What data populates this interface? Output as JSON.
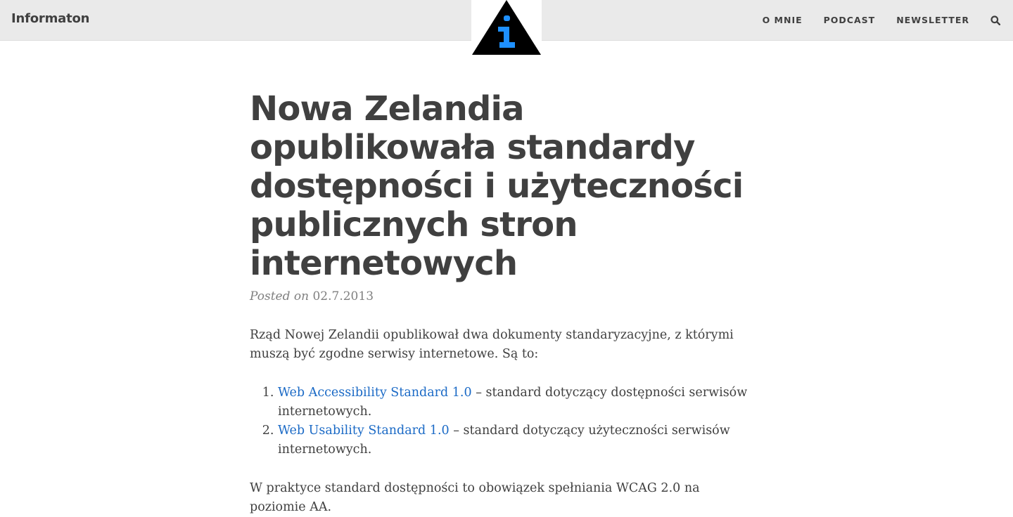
{
  "header": {
    "brand": "Informaton",
    "logo": {
      "icon": "info-triangle-icon",
      "colors": {
        "triangle": "#000000",
        "glyph": "#1e90ff"
      }
    },
    "nav": [
      {
        "label": "O MNIE"
      },
      {
        "label": "PODCAST"
      },
      {
        "label": "NEWSLETTER"
      }
    ],
    "search_icon": "search-icon"
  },
  "post": {
    "title": "Nowa Zelandia opublikowała standardy dostępności i użyteczności publicznych stron internetowych",
    "posted_on_label": "Posted on",
    "date": "02.7.2013",
    "intro": "Rząd Nowej Zelandii opublikował dwa dokumenty standaryzacyjne, z którymi muszą być zgodne serwisy internetowe. Są to:",
    "list": [
      {
        "link": "Web Accessibility Standard 1.0",
        "text": " – standard dotyczący dostępności serwisów internetowych."
      },
      {
        "link": "Web Usability Standard 1.0",
        "text": " – standard dotyczący użyteczności serwisów internetowych."
      }
    ],
    "paragraph2": "W praktyce standard dostępności to obowiązek spełniania WCAG 2.0 na poziomie AA."
  },
  "colors": {
    "navbar_bg": "#eaeaea",
    "text": "#404040",
    "meta": "#808080",
    "link": "#1b6ac6"
  }
}
